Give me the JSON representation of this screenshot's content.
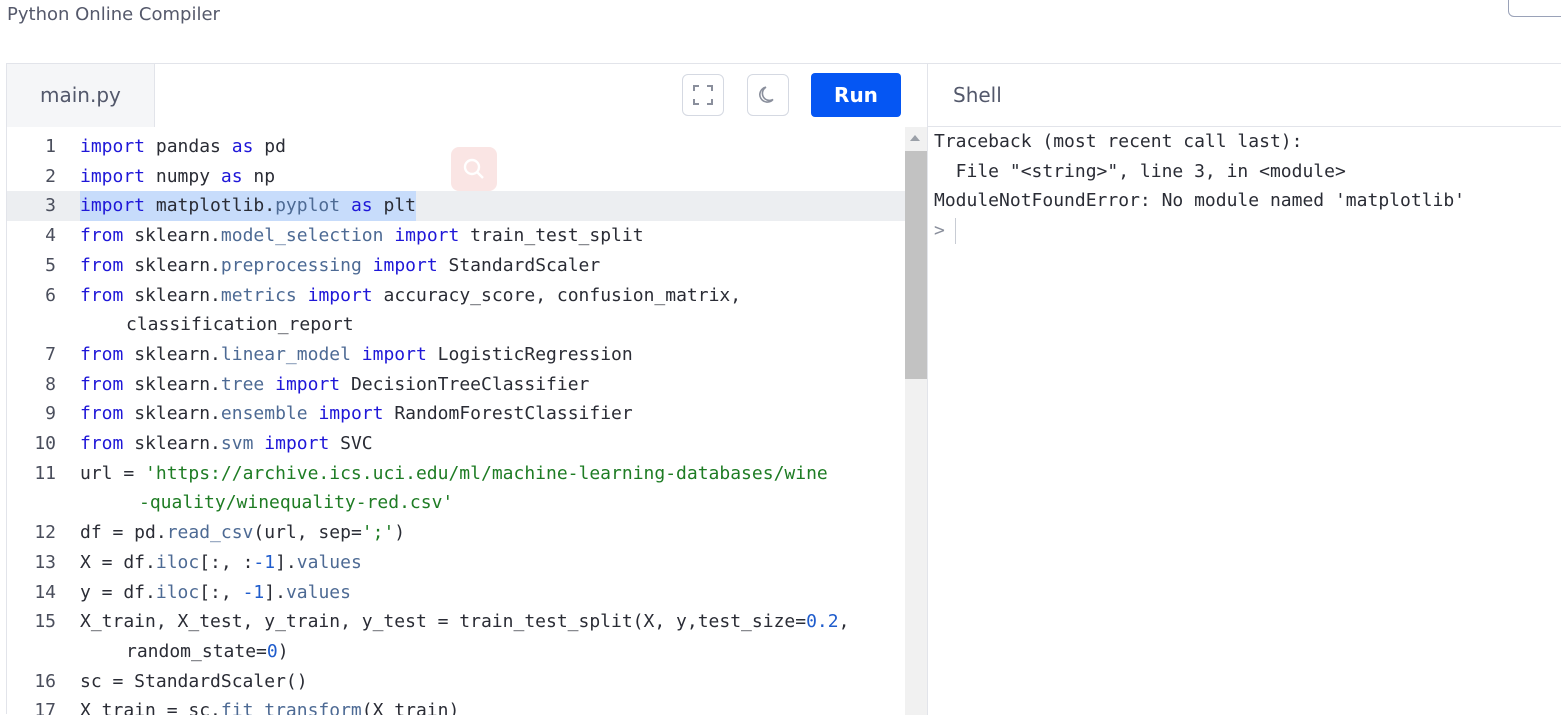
{
  "app": {
    "title": "Python Online Compiler"
  },
  "editor": {
    "file_tab": "main.py",
    "run_label": "Run",
    "icons": {
      "fullscreen": "fullscreen-icon",
      "theme": "moon-icon",
      "search": "search-icon"
    },
    "active_line": 3,
    "lines": [
      {
        "n": "1",
        "tokens": [
          [
            "kw",
            "import"
          ],
          [
            "t",
            " pandas "
          ],
          [
            "kw",
            "as"
          ],
          [
            "t",
            " pd"
          ]
        ]
      },
      {
        "n": "2",
        "tokens": [
          [
            "kw",
            "import"
          ],
          [
            "t",
            " numpy "
          ],
          [
            "kw",
            "as"
          ],
          [
            "t",
            " np"
          ]
        ]
      },
      {
        "n": "3",
        "tokens": [
          [
            "kw",
            "import"
          ],
          [
            "t",
            " matplotlib."
          ],
          [
            "fn",
            "pyplot"
          ],
          [
            "t",
            " "
          ],
          [
            "kw",
            "as"
          ],
          [
            "t",
            " plt"
          ]
        ],
        "selected": true
      },
      {
        "n": "4",
        "tokens": [
          [
            "kw",
            "from"
          ],
          [
            "t",
            " sklearn."
          ],
          [
            "fn",
            "model_selection"
          ],
          [
            "t",
            " "
          ],
          [
            "kw",
            "import"
          ],
          [
            "t",
            " train_test_split"
          ]
        ]
      },
      {
        "n": "5",
        "tokens": [
          [
            "kw",
            "from"
          ],
          [
            "t",
            " sklearn."
          ],
          [
            "fn",
            "preprocessing"
          ],
          [
            "t",
            " "
          ],
          [
            "kw",
            "import"
          ],
          [
            "t",
            " StandardScaler"
          ]
        ]
      },
      {
        "n": "6",
        "tokens": [
          [
            "kw",
            "from"
          ],
          [
            "t",
            " sklearn."
          ],
          [
            "fn",
            "metrics"
          ],
          [
            "t",
            " "
          ],
          [
            "kw",
            "import"
          ],
          [
            "t",
            " accuracy_score, confusion_matrix,"
          ]
        ],
        "cont": [
          [
            "t",
            "classification_report"
          ]
        ],
        "cont_indent": 46
      },
      {
        "n": "7",
        "tokens": [
          [
            "kw",
            "from"
          ],
          [
            "t",
            " sklearn."
          ],
          [
            "fn",
            "linear_model"
          ],
          [
            "t",
            " "
          ],
          [
            "kw",
            "import"
          ],
          [
            "t",
            " LogisticRegression"
          ]
        ]
      },
      {
        "n": "8",
        "tokens": [
          [
            "kw",
            "from"
          ],
          [
            "t",
            " sklearn."
          ],
          [
            "fn",
            "tree"
          ],
          [
            "t",
            " "
          ],
          [
            "kw",
            "import"
          ],
          [
            "t",
            " DecisionTreeClassifier"
          ]
        ]
      },
      {
        "n": "9",
        "tokens": [
          [
            "kw",
            "from"
          ],
          [
            "t",
            " sklearn."
          ],
          [
            "fn",
            "ensemble"
          ],
          [
            "t",
            " "
          ],
          [
            "kw",
            "import"
          ],
          [
            "t",
            " RandomForestClassifier"
          ]
        ]
      },
      {
        "n": "10",
        "tokens": [
          [
            "kw",
            "from"
          ],
          [
            "t",
            " sklearn."
          ],
          [
            "fn",
            "svm"
          ],
          [
            "t",
            " "
          ],
          [
            "kw",
            "import"
          ],
          [
            "t",
            " SVC"
          ]
        ]
      },
      {
        "n": "11",
        "tokens": [
          [
            "t",
            "url = "
          ],
          [
            "str",
            "'https://archive.ics.uci.edu/ml/machine-learning-databases/wine"
          ]
        ],
        "cont": [
          [
            "str",
            "-quality/winequality-red.csv'"
          ]
        ],
        "cont_indent": 59
      },
      {
        "n": "12",
        "tokens": [
          [
            "t",
            "df = pd."
          ],
          [
            "fn",
            "read_csv"
          ],
          [
            "t",
            "(url, sep="
          ],
          [
            "str",
            "';'"
          ],
          [
            "t",
            ")"
          ]
        ]
      },
      {
        "n": "13",
        "tokens": [
          [
            "t",
            "X = df."
          ],
          [
            "fn",
            "iloc"
          ],
          [
            "t",
            "[:, :"
          ],
          [
            "num",
            "-1"
          ],
          [
            "t",
            "]."
          ],
          [
            "fn",
            "values"
          ]
        ]
      },
      {
        "n": "14",
        "tokens": [
          [
            "t",
            "y = df."
          ],
          [
            "fn",
            "iloc"
          ],
          [
            "t",
            "[:, "
          ],
          [
            "num",
            "-1"
          ],
          [
            "t",
            "]."
          ],
          [
            "fn",
            "values"
          ]
        ]
      },
      {
        "n": "15",
        "tokens": [
          [
            "t",
            "X_train, X_test, y_train, y_test = train_test_split(X, y,test_size="
          ],
          [
            "num",
            "0.2"
          ],
          [
            "t",
            ","
          ]
        ],
        "cont": [
          [
            "t",
            "random_state="
          ],
          [
            "num",
            "0"
          ],
          [
            "t",
            ")"
          ]
        ],
        "cont_indent": 46
      },
      {
        "n": "16",
        "tokens": [
          [
            "t",
            "sc = StandardScaler()"
          ]
        ]
      },
      {
        "n": "17",
        "tokens": [
          [
            "t",
            "X_train = sc."
          ],
          [
            "fn",
            "fit_transform"
          ],
          [
            "t",
            "(X_train)"
          ]
        ]
      }
    ]
  },
  "shell": {
    "title": "Shell",
    "output": [
      "Traceback (most recent call last):",
      "  File \"<string>\", line 3, in <module>",
      "ModuleNotFoundError: No module named 'matplotlib'"
    ],
    "prompt": ">"
  },
  "colors": {
    "run_button": "#0556f3",
    "keyword": "#1f17d8",
    "string": "#1e7c24",
    "attribute": "#4d6a94",
    "selection": "#c7dcfb"
  }
}
